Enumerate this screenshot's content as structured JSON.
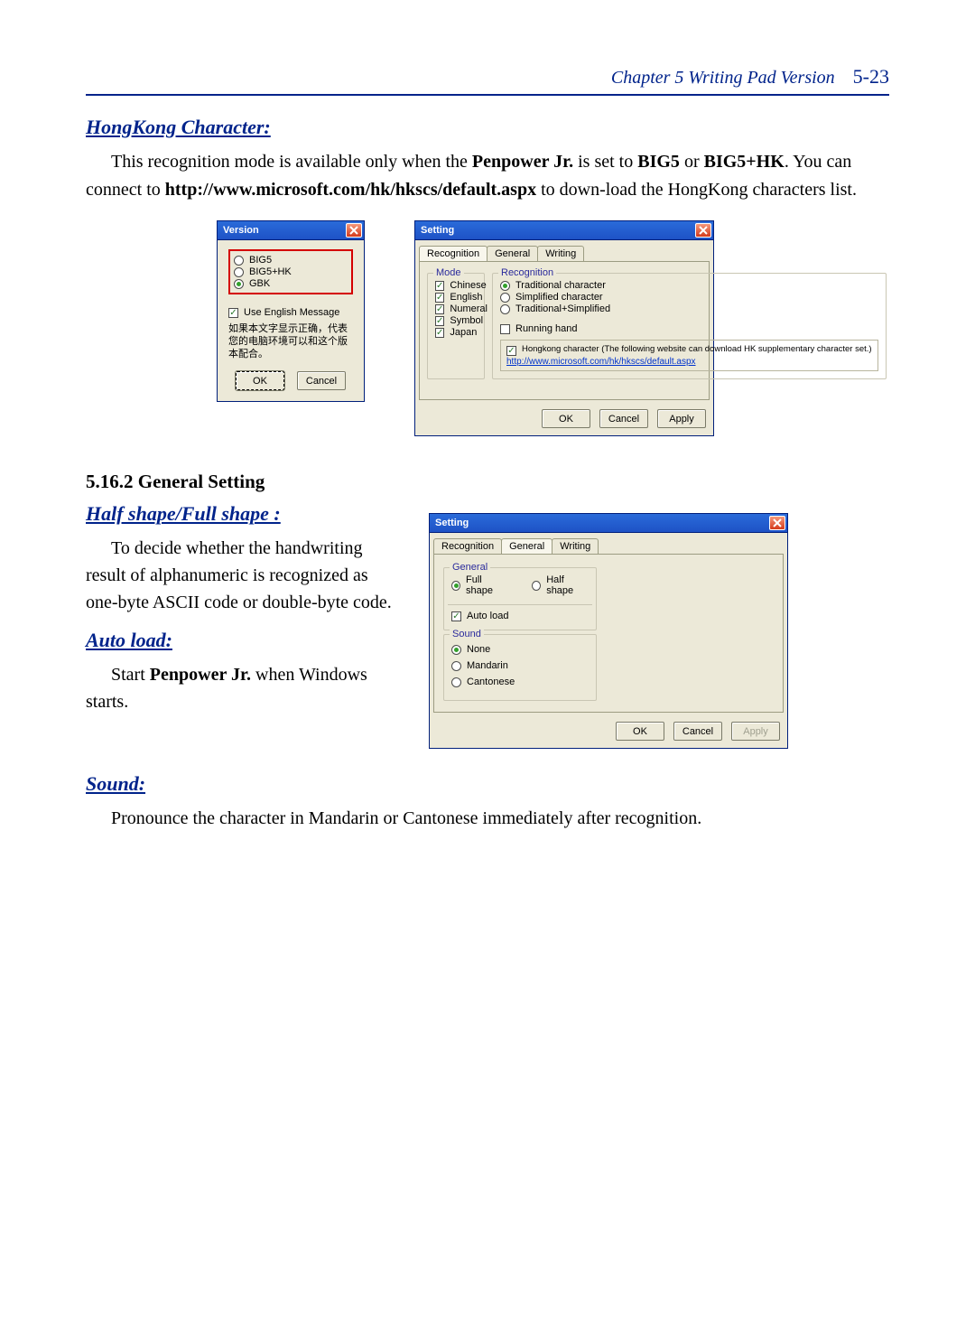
{
  "header": {
    "chapter": "Chapter 5 Writing Pad Version",
    "page": "5-23"
  },
  "hk": {
    "heading": "HongKong Character:",
    "para": "This recognition mode is available only when the Penpower Jr. is set to BIG5 or BIG5+HK. You can connect to http://www.microsoft.com/hk/hkscs/default.aspx to download the HongKong characters list."
  },
  "versionDialog": {
    "title": "Version",
    "radios": {
      "big5": "BIG5",
      "big5hk": "BIG5+HK",
      "gbk": "GBK"
    },
    "useEnglish": "Use English Message",
    "cjk": "如果本文字显示正确，代表您的电脑环境可以和这个版本配合。",
    "ok": "OK",
    "cancel": "Cancel"
  },
  "settingDialog": {
    "title": "Setting",
    "tabs": {
      "recognition": "Recognition",
      "general": "General",
      "writing": "Writing"
    },
    "mode": {
      "legend": "Mode",
      "chinese": "Chinese",
      "english": "English",
      "numeral": "Numeral",
      "symbol": "Symbol",
      "japan": "Japan"
    },
    "recognition": {
      "legend": "Recognition",
      "trad": "Traditional character",
      "simp": "Simplified character",
      "tradsimp": "Traditional+Simplified",
      "running": "Running hand",
      "hkdesc": "Hongkong character (The following website can download HK supplementary character set.)",
      "link": "http://www.microsoft.com/hk/hkscs/default.aspx"
    },
    "ok": "OK",
    "cancel": "Cancel",
    "apply": "Apply"
  },
  "generalSection": {
    "title": "5.16.2 General Setting",
    "half": {
      "heading": "Half shape/Full shape :",
      "para": "To decide whether the handwriting result of alphanumeric is recognized as one-byte ASCII code or double-byte code."
    },
    "auto": {
      "heading": "Auto load:",
      "para": "Start Penpower Jr. when Windows starts."
    },
    "sound": {
      "heading": "Sound:",
      "para": "Pronounce the character in Mandarin or Cantonese immediately after recognition."
    }
  },
  "setting2Dialog": {
    "title": "Setting",
    "tabs": {
      "recognition": "Recognition",
      "general": "General",
      "writing": "Writing"
    },
    "general": {
      "legend": "General",
      "full": "Full shape",
      "half": "Half shape",
      "auto": "Auto load"
    },
    "sound": {
      "legend": "Sound",
      "none": "None",
      "mandarin": "Mandarin",
      "cantonese": "Cantonese"
    },
    "ok": "OK",
    "cancel": "Cancel",
    "apply": "Apply"
  }
}
